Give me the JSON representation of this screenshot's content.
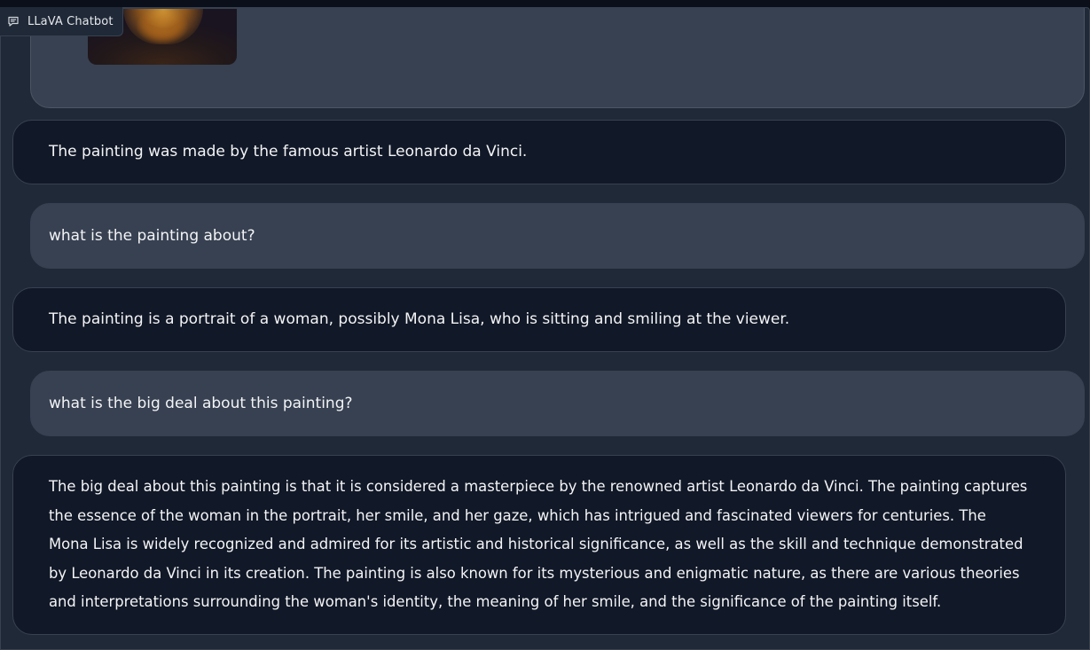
{
  "header": {
    "title": "LLaVA Chatbot",
    "icon": "chat-bubble-icon"
  },
  "chat": {
    "image_message": {
      "icon": "painting-thumbnail"
    },
    "messages": [
      {
        "role": "bot",
        "text": "The painting was made by the famous artist Leonardo da Vinci."
      },
      {
        "role": "user",
        "text": "what is the painting about?"
      },
      {
        "role": "bot",
        "text": "The painting is a portrait of a woman, possibly Mona Lisa, who is sitting and smiling at the viewer."
      },
      {
        "role": "user",
        "text": "what is the big deal about this painting?"
      },
      {
        "role": "bot",
        "text": "The big deal about this painting is that it is considered a masterpiece by the renowned artist Leonardo da Vinci. The painting captures the essence of the woman in the portrait, her smile, and her gaze, which has intrigued and fascinated viewers for centuries. The Mona Lisa is widely recognized and admired for its artistic and historical significance, as well as the skill and technique demonstrated by Leonardo da Vinci in its creation. The painting is also known for its mysterious and enigmatic nature, as there are various theories and interpretations surrounding the woman's identity, the meaning of her smile, and the significance of the painting itself."
      }
    ]
  },
  "colors": {
    "background": "#0b0f19",
    "panel": "#1f2937",
    "bot_bubble": "#111827",
    "user_bubble": "#374151",
    "border": "#374151",
    "text": "#f3f4f6"
  }
}
